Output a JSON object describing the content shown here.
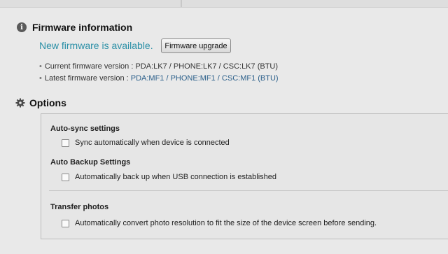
{
  "firmware": {
    "title": "Firmware information",
    "available_text": "New firmware is available.",
    "upgrade_button": "Firmware upgrade",
    "current_label": "Current firmware version : ",
    "current_value": "PDA:LK7 / PHONE:LK7 / CSC:LK7 (BTU)",
    "latest_label": "Latest firmware version : ",
    "latest_value": "PDA:MF1 / PHONE:MF1 / CSC:MF1 (BTU)"
  },
  "options": {
    "title": "Options",
    "auto_sync": {
      "label": "Auto-sync settings",
      "checkbox_label": "Sync automatically when device is connected",
      "checked": false
    },
    "auto_backup": {
      "label": "Auto Backup Settings",
      "checkbox_label": "Automatically back up when USB connection is established",
      "checked": false
    },
    "transfer_photos": {
      "label": "Transfer photos",
      "checkbox_label": "Automatically convert photo resolution to fit the size of the device screen before sending.",
      "checked": false
    }
  },
  "colors": {
    "accent_text": "#2a8fa6",
    "latest_value_text": "#2b5f8a"
  },
  "icons": {
    "firmware_icon": "info-icon",
    "options_icon": "gear-icon"
  }
}
